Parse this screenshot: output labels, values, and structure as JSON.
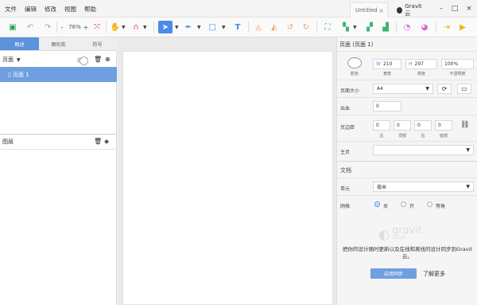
{
  "menu": [
    "文件",
    "编辑",
    "修改",
    "视图",
    "帮助"
  ],
  "tabs": {
    "untitled": "Untitled",
    "gravit": "Gravit 云"
  },
  "toolbar": {
    "zoom_minus": "-",
    "zoom": "76%",
    "zoom_plus": "+",
    "text_tool": "T"
  },
  "left": {
    "tabs": [
      "概述",
      "图形库",
      "符号"
    ],
    "pages_title": "页面",
    "page_item": "页面 1",
    "layers_title": "图层"
  },
  "right": {
    "title": "页面 (页面 1)",
    "fill_label": "颜色",
    "width_prefix": "W",
    "width": "210",
    "width_label": "宽度",
    "height_prefix": "H",
    "height": "297",
    "height_label": "高度",
    "opacity": "100%",
    "opacity_label": "不透明度",
    "page_size_label": "页面大小",
    "page_size": "A4",
    "bleed_label": "出血",
    "bleed": "0",
    "margin_label": "页边距",
    "margins": [
      "0",
      "0",
      "0",
      "0"
    ],
    "margin_sublabels": [
      "左",
      "顶部",
      "右",
      "底部"
    ],
    "master_label": "主页",
    "master": "",
    "document_title": "文档",
    "unit_label": "单元",
    "unit": "毫米",
    "grid_label": "网格",
    "grid_options": [
      "关",
      "开",
      "等角"
    ],
    "cloud_logo": "gravit",
    "cloud_sub": "cloud",
    "cloud_msg": "把你的设计随时更新以及在线和离线的设计同步到Gravit云。",
    "sync_button": "启用同步",
    "learn_more": "了解更多"
  },
  "colors": {
    "accent": "#4a8ce8",
    "selected_row": "#6f9fe0",
    "active_tab": "#5b93dd"
  }
}
